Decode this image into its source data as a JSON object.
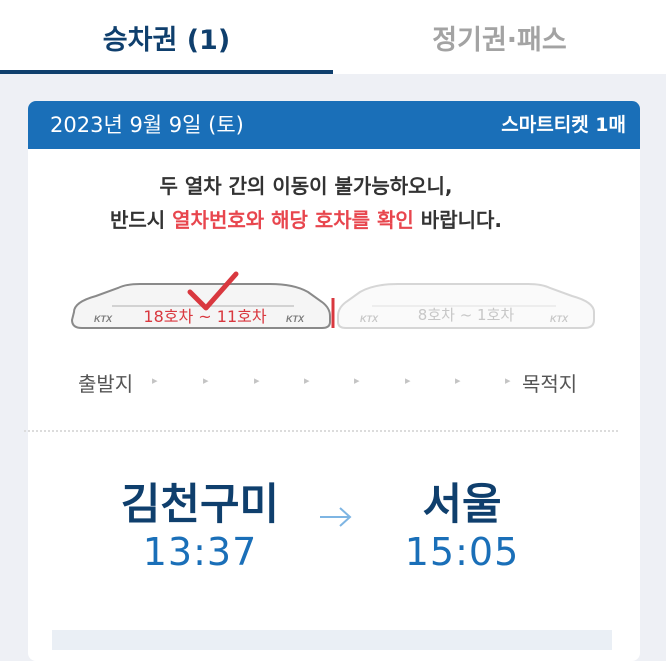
{
  "tabs": {
    "active_label": "승차권 (1)",
    "inactive_label": "정기권·패스"
  },
  "card": {
    "date": "2023년 9월 9일 (토)",
    "ticket_type": "스마트티켓 1매"
  },
  "notice": {
    "line1": "두 열차 간의 이동이 불가능하오니,",
    "line2_pre": "반드시 ",
    "line2_highlight": "열차번호와 해당 호차를 확인",
    "line2_post": " 바랍니다."
  },
  "train": {
    "front_cars": "18호차 ~ 11호차",
    "rear_cars": "8호차 ~ 1호차",
    "logo": "KTX"
  },
  "route": {
    "departure_label": "출발지",
    "destination_label": "목적지",
    "arrow_glyph": "▸"
  },
  "journey": {
    "from_station": "김천구미",
    "from_time": "13:37",
    "to_station": "서울",
    "to_time": "15:05"
  },
  "colors": {
    "brand_navy": "#0f3f6d",
    "header_blue": "#1a6fb8",
    "highlight_red": "#e8464e",
    "check_red": "#d9383f"
  }
}
